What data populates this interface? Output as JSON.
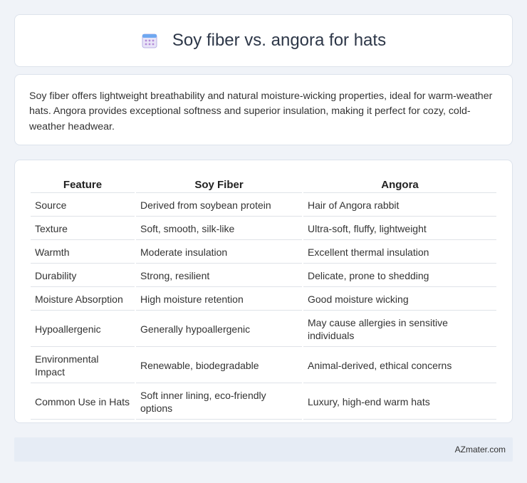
{
  "header": {
    "title": "Soy fiber vs. angora for hats",
    "icon": "calendar-icon"
  },
  "intro": {
    "text": "Soy fiber offers lightweight breathability and natural moisture-wicking properties, ideal for warm-weather hats. Angora provides exceptional softness and superior insulation, making it perfect for cozy, cold-weather headwear."
  },
  "table": {
    "headers": [
      "Feature",
      "Soy Fiber",
      "Angora"
    ],
    "rows": [
      [
        "Source",
        "Derived from soybean protein",
        "Hair of Angora rabbit"
      ],
      [
        "Texture",
        "Soft, smooth, silk-like",
        "Ultra-soft, fluffy, lightweight"
      ],
      [
        "Warmth",
        "Moderate insulation",
        "Excellent thermal insulation"
      ],
      [
        "Durability",
        "Strong, resilient",
        "Delicate, prone to shedding"
      ],
      [
        "Moisture Absorption",
        "High moisture retention",
        "Good moisture wicking"
      ],
      [
        "Hypoallergenic",
        "Generally hypoallergenic",
        "May cause allergies in sensitive individuals"
      ],
      [
        "Environmental Impact",
        "Renewable, biodegradable",
        "Animal-derived, ethical concerns"
      ],
      [
        "Common Use in Hats",
        "Soft inner lining, eco-friendly options",
        "Luxury, high-end warm hats"
      ]
    ]
  },
  "footer": {
    "text": "AZmater.com"
  }
}
